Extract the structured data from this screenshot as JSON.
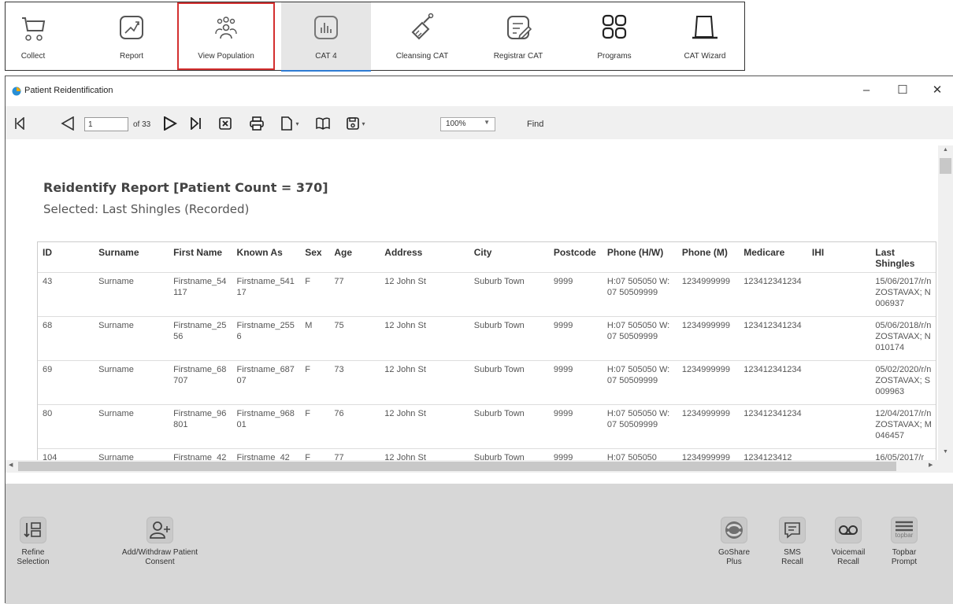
{
  "top_toolbar": {
    "items": [
      {
        "label": "Collect",
        "icon": "collect-icon"
      },
      {
        "label": "Report",
        "icon": "report-icon"
      },
      {
        "label": "View Population",
        "icon": "population-icon",
        "highlighted": true
      },
      {
        "label": "CAT 4",
        "icon": "cat4-icon",
        "active": true
      },
      {
        "label": "Cleansing CAT",
        "icon": "cleansing-icon"
      },
      {
        "label": "Registrar CAT",
        "icon": "registrar-icon"
      },
      {
        "label": "Programs",
        "icon": "programs-icon"
      },
      {
        "label": "CAT Wizard",
        "icon": "wizard-hat-icon"
      }
    ]
  },
  "window": {
    "title": "Patient Reidentification",
    "controls": {
      "minimize": "–",
      "maximize": "☐",
      "close": "✕"
    }
  },
  "report_toolbar": {
    "page_current": "1",
    "page_of": "of 33",
    "zoom": "100%",
    "find": "Find"
  },
  "report": {
    "heading": "Reidentify Report  [Patient Count = 370]",
    "subheading": "Selected: Last Shingles (Recorded)",
    "columns": [
      "ID",
      "Surname",
      "First Name",
      "Known As",
      "Sex",
      "Age",
      "Address",
      "City",
      "Postcode",
      "Phone (H/W)",
      "Phone (M)",
      "Medicare",
      "IHI",
      "Last Shingles"
    ],
    "rows": [
      [
        "43",
        "Surname",
        "Firstname_54117",
        "Firstname_54117",
        "F",
        "77",
        "12 John St",
        "Suburb Town",
        "9999",
        "H:07 505050 W:07 50509999",
        "1234999999",
        "123412341234",
        "",
        "15/06/2017/r/nZOSTAVAX; N006937"
      ],
      [
        "68",
        "Surname",
        "Firstname_2556",
        "Firstname_2556",
        "M",
        "75",
        "12 John St",
        "Suburb Town",
        "9999",
        "H:07 505050 W:07 50509999",
        "1234999999",
        "123412341234",
        "",
        "05/06/2018/r/nZOSTAVAX; N010174"
      ],
      [
        "69",
        "Surname",
        "Firstname_68707",
        "Firstname_68707",
        "F",
        "73",
        "12 John St",
        "Suburb Town",
        "9999",
        "H:07 505050 W:07 50509999",
        "1234999999",
        "123412341234",
        "",
        "05/02/2020/r/nZOSTAVAX; S009963"
      ],
      [
        "80",
        "Surname",
        "Firstname_96801",
        "Firstname_96801",
        "F",
        "76",
        "12 John St",
        "Suburb Town",
        "9999",
        "H:07 505050 W:07 50509999",
        "1234999999",
        "123412341234",
        "",
        "12/04/2017/r/nZOSTAVAX; M046457"
      ],
      [
        "104",
        "Surname",
        "Firstname_42",
        "Firstname_42",
        "F",
        "77",
        "12 John St",
        "Suburb Town",
        "9999",
        "H:07 505050",
        "1234999999",
        "1234123412",
        "",
        "16/05/2017/r"
      ]
    ]
  },
  "bottom_actions": {
    "left": [
      {
        "label": "Refine Selection",
        "icon": "refine-selection-icon"
      },
      {
        "label": "Add/Withdraw Patient Consent",
        "icon": "add-user-icon"
      }
    ],
    "right": [
      {
        "label": "GoShare Plus",
        "icon": "goshare-icon"
      },
      {
        "label": "SMS Recall",
        "icon": "sms-icon"
      },
      {
        "label": "Voicemail Recall",
        "icon": "voicemail-icon"
      },
      {
        "label": "Topbar Prompt",
        "icon": "topbar-icon",
        "icon_text": "topbar"
      }
    ]
  },
  "colors": {
    "highlight": "#d32f2f",
    "active_underline": "#2d7bd4",
    "panel_bg": "#d7d7d7"
  }
}
